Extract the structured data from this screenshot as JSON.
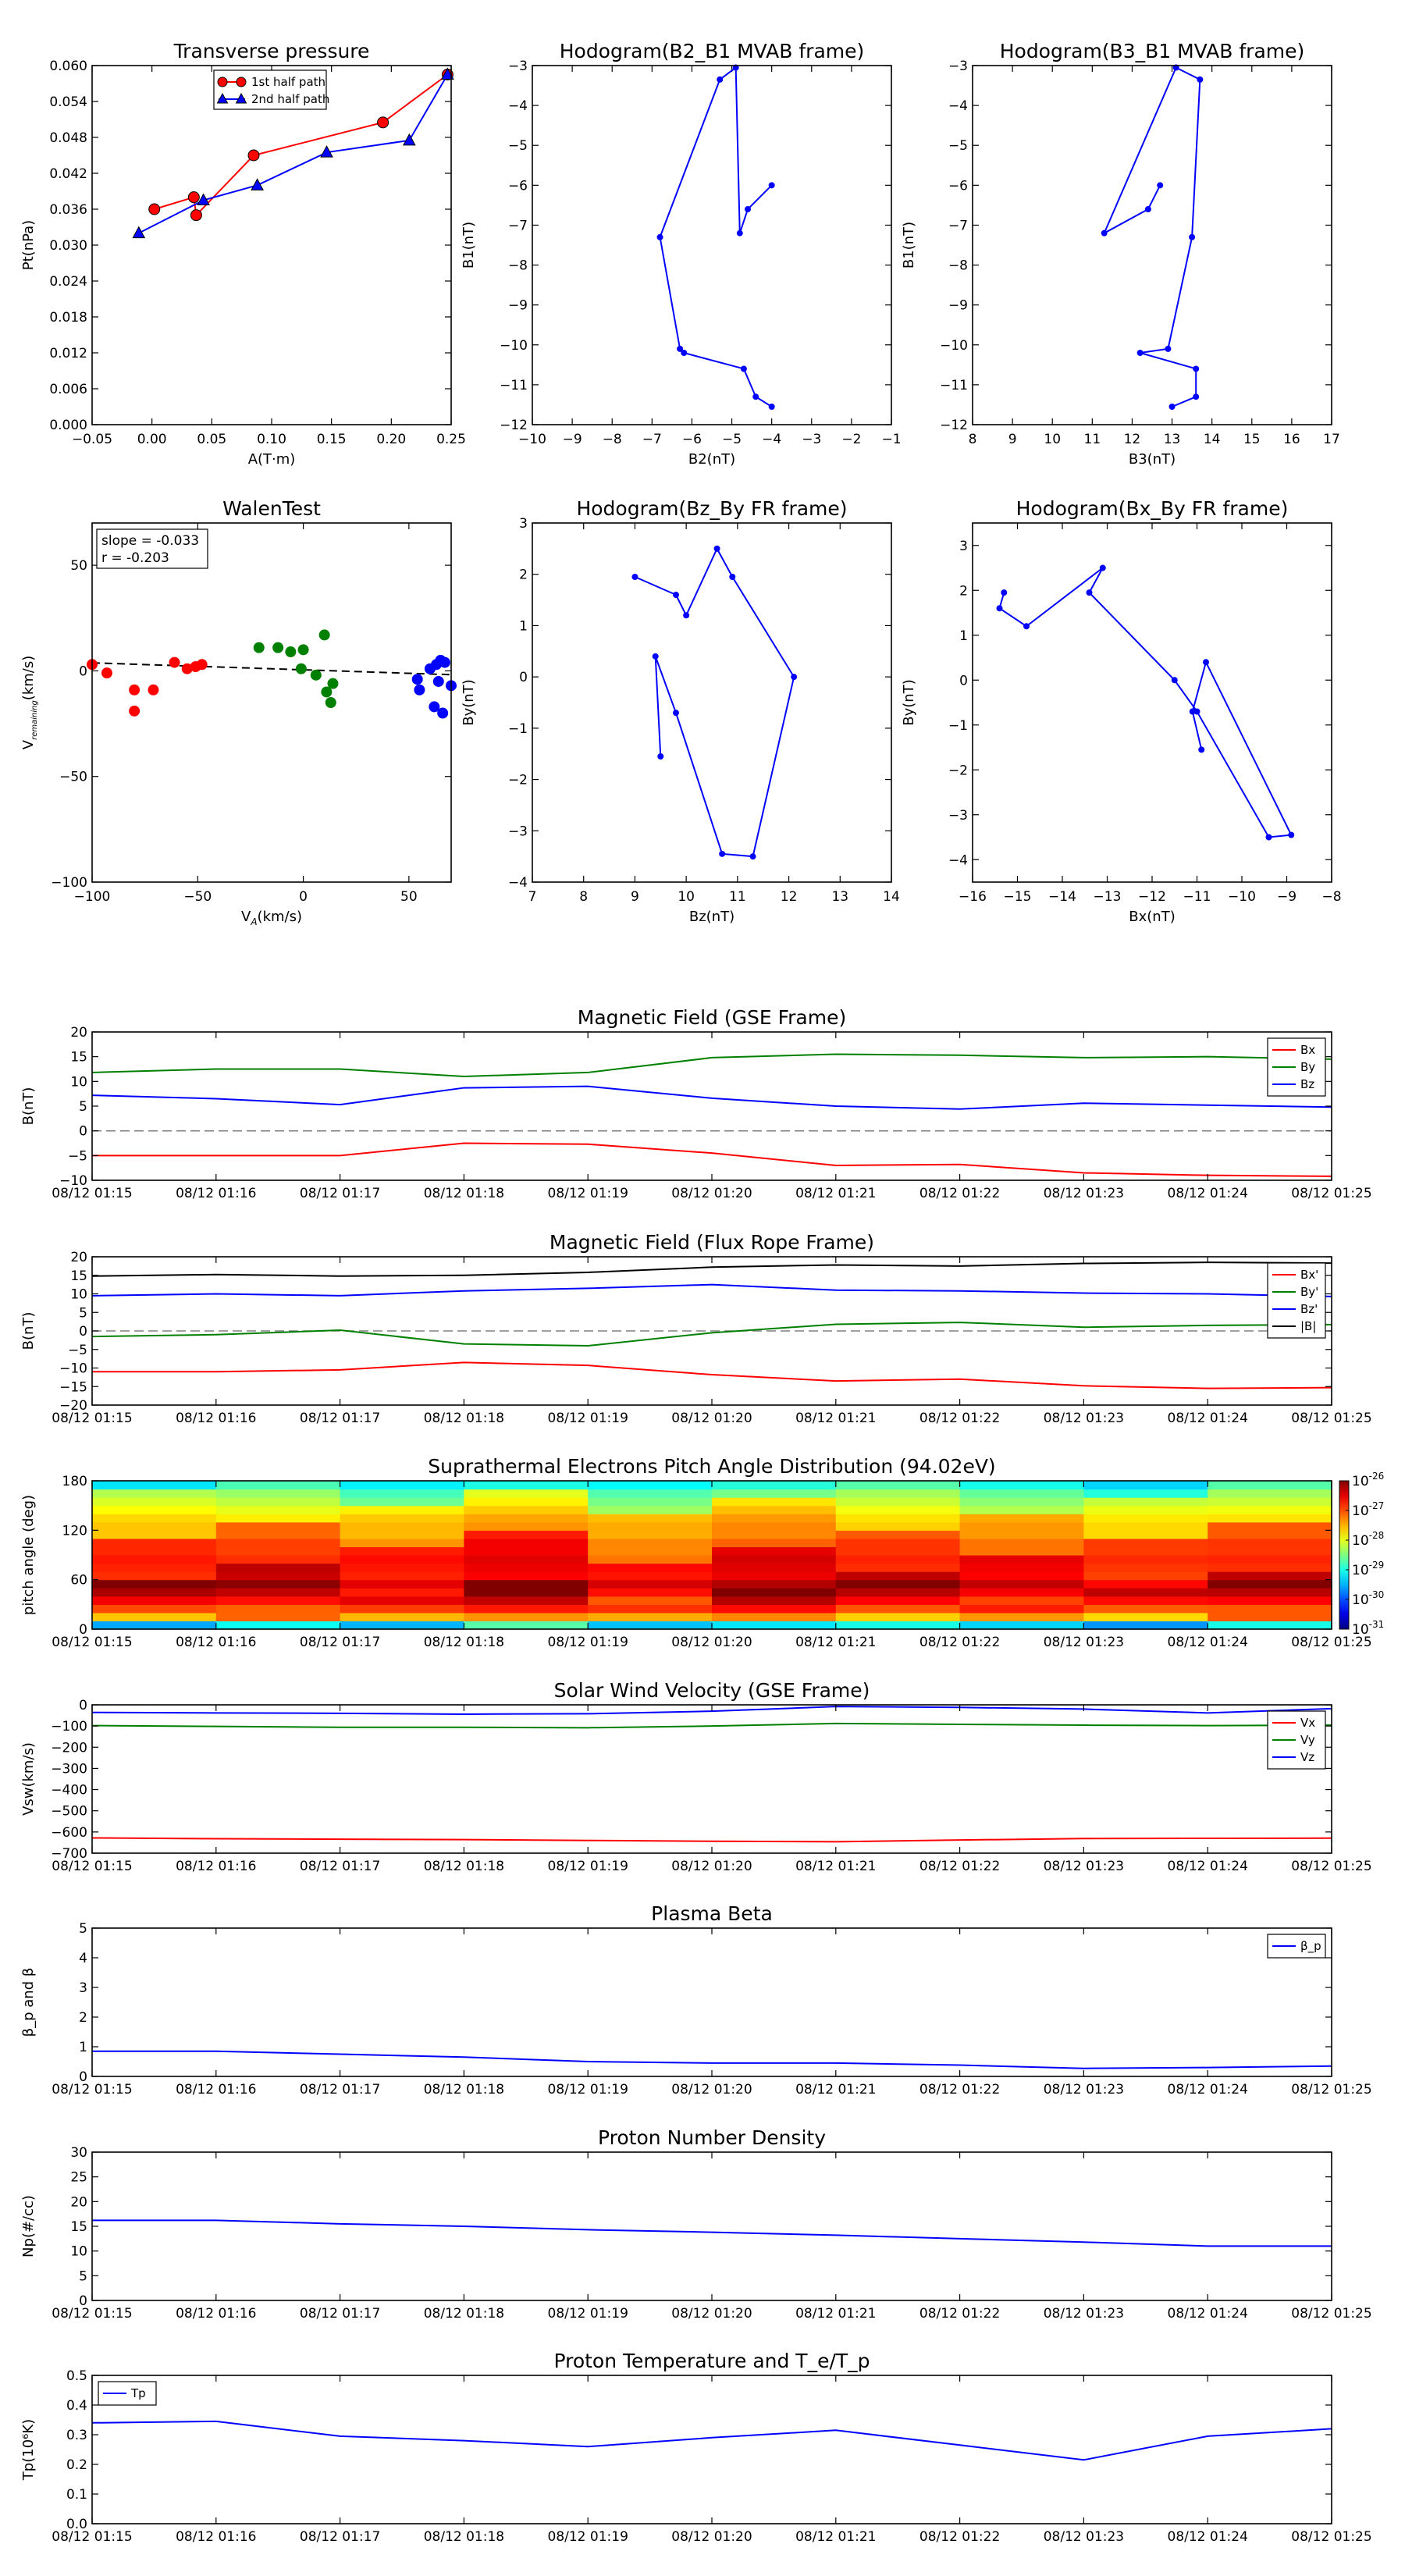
{
  "time_ticks": [
    "08/12 01:15",
    "08/12 01:16",
    "08/12 01:17",
    "08/12 01:18",
    "08/12 01:19",
    "08/12 01:20",
    "08/12 01:21",
    "08/12 01:22",
    "08/12 01:23",
    "08/12 01:24",
    "08/12 01:25"
  ],
  "chart_data": [
    {
      "type": "line",
      "title": "Transverse pressure",
      "xlabel": "A(T·m)",
      "ylabel": "Pt(nPa)",
      "xlim": [
        -0.05,
        0.25
      ],
      "ylim": [
        0.0,
        0.06
      ],
      "xticks": [
        "−0.05",
        "0.00",
        "0.05",
        "0.10",
        "0.15",
        "0.20",
        "0.25"
      ],
      "yticks": [
        "0.000",
        "0.006",
        "0.012",
        "0.018",
        "0.024",
        "0.030",
        "0.036",
        "0.042",
        "0.048",
        "0.054",
        "0.060"
      ],
      "legend": "top-center",
      "series": [
        {
          "name": "1st half path",
          "color": "#ff0000",
          "marker": "circle",
          "x": [
            0.002,
            0.035,
            0.037,
            0.085,
            0.193,
            0.247
          ],
          "y": [
            0.036,
            0.038,
            0.035,
            0.045,
            0.0505,
            0.0585
          ]
        },
        {
          "name": "2nd half path",
          "color": "#0000ff",
          "marker": "triangle",
          "x": [
            -0.011,
            0.043,
            0.088,
            0.146,
            0.215,
            0.247
          ],
          "y": [
            0.032,
            0.0375,
            0.04,
            0.0455,
            0.0475,
            0.0585
          ]
        }
      ]
    },
    {
      "type": "line",
      "title": "Hodogram(B2_B1 MVAB frame)",
      "xlabel": "B2(nT)",
      "ylabel": "B1(nT)",
      "xlim": [
        -10,
        -1
      ],
      "ylim": [
        -12,
        -3
      ],
      "xticks": [
        "−10",
        "−9",
        "−8",
        "−7",
        "−6",
        "−5",
        "−4",
        "−3",
        "−2",
        "−1"
      ],
      "yticks": [
        "−12",
        "−11",
        "−10",
        "−9",
        "−8",
        "−7",
        "−6",
        "−5",
        "−4",
        "−3"
      ],
      "series": [
        {
          "color": "#0000ff",
          "x": [
            -4.0,
            -4.6,
            -4.8,
            -4.9,
            -5.3,
            -6.8,
            -6.3,
            -6.2,
            -4.7,
            -4.4,
            -4.0
          ],
          "y": [
            -6.0,
            -6.6,
            -7.2,
            -3.05,
            -3.35,
            -7.3,
            -10.1,
            -10.2,
            -10.6,
            -11.3,
            -11.55
          ]
        }
      ]
    },
    {
      "type": "line",
      "title": "Hodogram(B3_B1 MVAB frame)",
      "xlabel": "B3(nT)",
      "ylabel": "B1(nT)",
      "xlim": [
        8,
        17
      ],
      "ylim": [
        -12,
        -3
      ],
      "xticks": [
        "8",
        "9",
        "10",
        "11",
        "12",
        "13",
        "14",
        "15",
        "16",
        "17"
      ],
      "yticks": [
        "−12",
        "−11",
        "−10",
        "−9",
        "−8",
        "−7",
        "−6",
        "−5",
        "−4",
        "−3"
      ],
      "series": [
        {
          "color": "#0000ff",
          "x": [
            12.7,
            12.4,
            11.3,
            13.1,
            13.7,
            13.5,
            12.9,
            12.2,
            13.6,
            13.6,
            13.0
          ],
          "y": [
            -6.0,
            -6.6,
            -7.2,
            -3.05,
            -3.35,
            -7.3,
            -10.1,
            -10.2,
            -10.6,
            -11.3,
            -11.55
          ]
        }
      ]
    },
    {
      "type": "scatter",
      "title": "WalenTest",
      "xlabel": "V",
      "xlabel_sub": "A",
      "xlabel_unit": "(km/s)",
      "ylabel": "V",
      "ylabel_sub": "remaining",
      "ylabel_unit": "(km/s)",
      "xlim": [
        -100,
        70
      ],
      "ylim": [
        -100,
        70
      ],
      "xticks": [
        "−100",
        "−50",
        "0",
        "50"
      ],
      "yticks": [
        "−100",
        "−50",
        "0",
        "50"
      ],
      "annotation": [
        "slope = -0.033",
        "r = -0.203"
      ],
      "fit": {
        "slope": -0.033,
        "intercept": 0.5
      },
      "series": [
        {
          "color": "#ff0000",
          "x": [
            -100,
            -93,
            -80,
            -80,
            -71,
            -61,
            -55,
            -51,
            -48
          ],
          "y": [
            3,
            -1,
            -9,
            -19,
            -9,
            4,
            1,
            2,
            3
          ]
        },
        {
          "color": "#008000",
          "x": [
            -21,
            -12,
            -6,
            0,
            -1,
            6,
            10,
            11,
            13,
            14
          ],
          "y": [
            11,
            11,
            9,
            10,
            1,
            -2,
            17,
            -10,
            -15,
            -6
          ]
        },
        {
          "color": "#0000ff",
          "x": [
            54,
            55,
            60,
            62,
            63,
            64,
            65,
            66,
            67,
            70
          ],
          "y": [
            -4,
            -9,
            1,
            -17,
            3,
            -5,
            5,
            -20,
            4,
            -7
          ]
        }
      ]
    },
    {
      "type": "line",
      "title": "Hodogram(Bz_By FR frame)",
      "xlabel": "Bz(nT)",
      "ylabel": "By(nT)",
      "xlim": [
        7,
        14
      ],
      "ylim": [
        -4,
        3
      ],
      "xticks": [
        "7",
        "8",
        "9",
        "10",
        "11",
        "12",
        "13",
        "14"
      ],
      "yticks": [
        "−4",
        "−3",
        "−2",
        "−1",
        "0",
        "1",
        "2",
        "3"
      ],
      "series": [
        {
          "color": "#0000ff",
          "x": [
            9.0,
            9.8,
            10.0,
            10.6,
            10.9,
            12.1,
            11.3,
            10.7,
            9.8,
            9.4,
            9.5
          ],
          "y": [
            1.95,
            1.6,
            1.2,
            2.5,
            1.95,
            0.0,
            -3.5,
            -3.45,
            -0.7,
            0.4,
            -1.55
          ]
        }
      ]
    },
    {
      "type": "line",
      "title": "Hodogram(Bx_By FR frame)",
      "xlabel": "Bx(nT)",
      "ylabel": "By(nT)",
      "xlim": [
        -16,
        -8
      ],
      "ylim": [
        -4.5,
        3.5
      ],
      "xticks": [
        "−16",
        "−15",
        "−14",
        "−13",
        "−12",
        "−11",
        "−10",
        "−9",
        "−8"
      ],
      "yticks": [
        "−4",
        "−3",
        "−2",
        "−1",
        "0",
        "1",
        "2",
        "3"
      ],
      "series": [
        {
          "color": "#0000ff",
          "x": [
            -15.3,
            -15.4,
            -14.8,
            -13.1,
            -13.4,
            -11.5,
            -11.0,
            -9.4,
            -8.9,
            -10.8,
            -11.1,
            -10.9
          ],
          "y": [
            1.95,
            1.6,
            1.2,
            2.5,
            1.95,
            0.0,
            -0.7,
            -3.5,
            -3.45,
            0.4,
            -0.7,
            -1.55
          ]
        }
      ]
    },
    {
      "type": "line",
      "title": "Magnetic Field (GSE Frame)",
      "ylabel": "B(nT)",
      "ylim": [
        -10,
        20
      ],
      "yticks": [
        "−10",
        "−5",
        "0",
        "5",
        "10",
        "15",
        "20"
      ],
      "zero_line": true,
      "legend": "top-right",
      "series": [
        {
          "name": "Bx",
          "color": "#ff0000",
          "values": [
            -5.0,
            -5.0,
            -5.0,
            -2.5,
            -2.7,
            -4.5,
            -7.0,
            -6.8,
            -8.5,
            -9.0,
            -9.2
          ]
        },
        {
          "name": "By",
          "color": "#008000",
          "values": [
            11.8,
            12.5,
            12.5,
            11.0,
            11.8,
            14.8,
            15.5,
            15.3,
            14.8,
            15.0,
            14.5
          ]
        },
        {
          "name": "Bz",
          "color": "#0000ff",
          "values": [
            7.2,
            6.5,
            5.3,
            8.7,
            9.0,
            6.6,
            5.0,
            4.4,
            5.6,
            5.2,
            4.8
          ]
        }
      ]
    },
    {
      "type": "line",
      "title": "Magnetic Field (Flux Rope Frame)",
      "ylabel": "B(nT)",
      "ylim": [
        -20,
        20
      ],
      "yticks": [
        "−20",
        "−15",
        "−10",
        "−5",
        "0",
        "5",
        "10",
        "15",
        "20"
      ],
      "zero_line": true,
      "legend": "top-right",
      "series": [
        {
          "name": "Bx'",
          "color": "#ff0000",
          "values": [
            -11,
            -11,
            -10.5,
            -8.5,
            -9.3,
            -11.8,
            -13.5,
            -13,
            -14.8,
            -15.5,
            -15.3
          ]
        },
        {
          "name": "By'",
          "color": "#008000",
          "values": [
            -1.5,
            -1.0,
            0.2,
            -3.5,
            -4.0,
            -0.5,
            1.8,
            2.3,
            1.0,
            1.5,
            1.7
          ]
        },
        {
          "name": "Bz'",
          "color": "#0000ff",
          "values": [
            9.5,
            10.0,
            9.5,
            10.8,
            11.5,
            12.5,
            11.0,
            10.8,
            10.2,
            10.0,
            9.3
          ]
        },
        {
          "name": "|B|",
          "color": "#000000",
          "values": [
            14.8,
            15.2,
            14.8,
            15.0,
            15.8,
            17.2,
            17.8,
            17.5,
            18.2,
            18.5,
            18.3
          ]
        }
      ]
    },
    {
      "type": "heatmap",
      "title": "Suprathermal Electrons Pitch Angle Distribution (94.02eV)",
      "ylabel": "pitch angle (deg)",
      "ylim": [
        0,
        180
      ],
      "yticks": [
        "0",
        "60",
        "120",
        "180"
      ],
      "colorbar_ticks": [
        "10^-31",
        "10^-30",
        "10^-29",
        "10^-28",
        "10^-27",
        "10^-26"
      ],
      "columns": 10,
      "bins": 18,
      "level_base": [
        0.35,
        0.72,
        0.82,
        0.88,
        0.93,
        0.96,
        0.88,
        0.87,
        0.86,
        0.82,
        0.8,
        0.74,
        0.72,
        0.68,
        0.62,
        0.56,
        0.5,
        0.4
      ],
      "level_column_offset": [
        0.0,
        0.02,
        -0.02,
        0.06,
        -0.04,
        0.04,
        0.01,
        -0.01,
        -0.03,
        0.02
      ]
    },
    {
      "type": "line",
      "title": "Solar Wind Velocity (GSE Frame)",
      "ylabel": "Vsw(km/s)",
      "ylim": [
        -700,
        0
      ],
      "yticks": [
        "−700",
        "−600",
        "−500",
        "−400",
        "−300",
        "−200",
        "−100",
        "0"
      ],
      "legend": "top-right",
      "series": [
        {
          "name": "Vx",
          "color": "#ff0000",
          "values": [
            -628,
            -632,
            -634,
            -636,
            -640,
            -644,
            -646,
            -638,
            -631,
            -630,
            -629
          ]
        },
        {
          "name": "Vy",
          "color": "#008000",
          "values": [
            -98,
            -102,
            -106,
            -106,
            -108,
            -100,
            -88,
            -92,
            -96,
            -98,
            -96
          ]
        },
        {
          "name": "Vz",
          "color": "#0000ff",
          "values": [
            -36,
            -38,
            -40,
            -44,
            -42,
            -30,
            -8,
            -12,
            -20,
            -38,
            -18
          ]
        }
      ]
    },
    {
      "type": "line",
      "title": "Plasma Beta",
      "ylabel": "β_p and β",
      "ylim": [
        0,
        5
      ],
      "yticks": [
        "0",
        "1",
        "2",
        "3",
        "4",
        "5"
      ],
      "legend": "top-right",
      "series": [
        {
          "name": "β_p",
          "color": "#0000ff",
          "values": [
            0.85,
            0.85,
            0.75,
            0.65,
            0.5,
            0.45,
            0.45,
            0.38,
            0.27,
            0.3,
            0.35
          ]
        }
      ]
    },
    {
      "type": "line",
      "title": "Proton Number Density",
      "ylabel": "Np(#/cc)",
      "ylim": [
        0,
        30
      ],
      "yticks": [
        "0",
        "5",
        "10",
        "15",
        "20",
        "25",
        "30"
      ],
      "series": [
        {
          "color": "#0000ff",
          "values": [
            16.2,
            16.2,
            15.5,
            15.0,
            14.3,
            13.8,
            13.2,
            12.5,
            11.8,
            11.0,
            11.0
          ]
        }
      ]
    },
    {
      "type": "line",
      "title": "Proton Temperature and T_e/T_p",
      "ylabel": "Tp(10⁶K)",
      "ylim": [
        0,
        0.5
      ],
      "yticks": [
        "0.0",
        "0.1",
        "0.2",
        "0.3",
        "0.4",
        "0.5"
      ],
      "legend": "top-left",
      "series": [
        {
          "name": "Tp",
          "color": "#0000ff",
          "values": [
            0.34,
            0.345,
            0.295,
            0.28,
            0.26,
            0.29,
            0.315,
            0.265,
            0.215,
            0.295,
            0.32
          ]
        }
      ]
    }
  ]
}
